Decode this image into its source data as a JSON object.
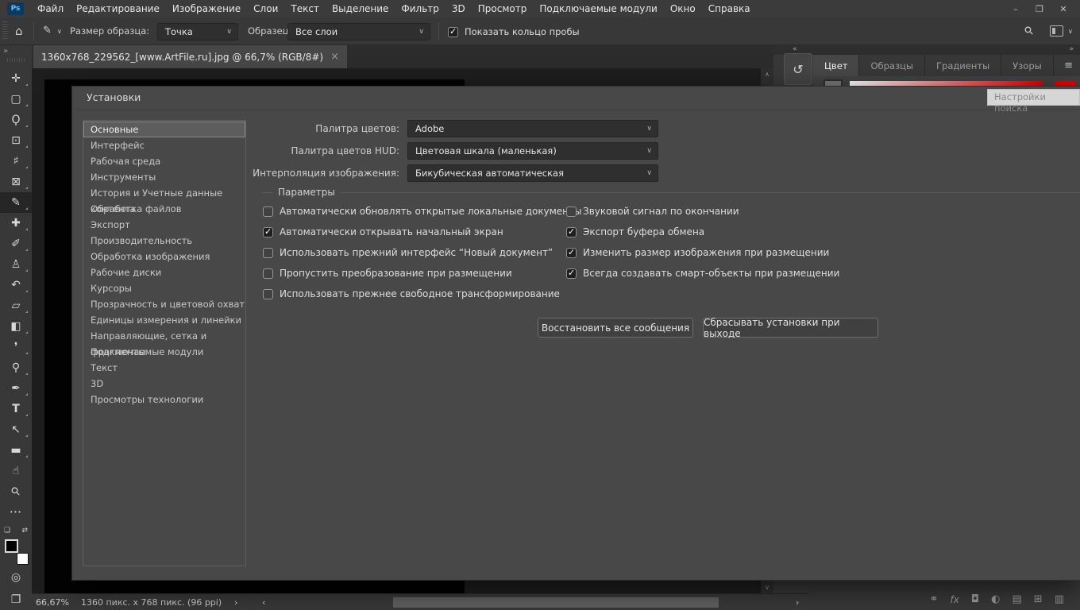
{
  "app": {
    "logo": "Ps"
  },
  "menu_bar": {
    "items": [
      {
        "label": "Файл"
      },
      {
        "label": "Редактирование"
      },
      {
        "label": "Изображение"
      },
      {
        "label": "Слои"
      },
      {
        "label": "Текст"
      },
      {
        "label": "Выделение"
      },
      {
        "label": "Фильтр"
      },
      {
        "label": "3D"
      },
      {
        "label": "Просмотр"
      },
      {
        "label": "Подключаемые модули"
      },
      {
        "label": "Окно"
      },
      {
        "label": "Справка"
      }
    ]
  },
  "window_controls": {
    "minimize": "–",
    "restore": "❐",
    "close": "✕"
  },
  "options_bar": {
    "home_icon": "⌂",
    "eyedropper_icon": "✎",
    "chevron": "∨",
    "sample_size_label": "Размер образца:",
    "sample_size_value": "Точка",
    "sample_label": "Образец:",
    "sample_value": "Все слои",
    "show_sampling_ring": {
      "label": "Показать кольцо пробы",
      "checked": true
    },
    "search_icon": "⚲",
    "workspace_chevron": "∨"
  },
  "document_tab": {
    "title": "1360x768_229562_[www.ArtFile.ru].jpg @ 66,7% (RGB/8#)",
    "close_icon": "×"
  },
  "toolbar": {
    "collapse_icon": "»",
    "tools": [
      {
        "name": "move",
        "glyph": "✛",
        "selected": false
      },
      {
        "name": "rectangular-marquee",
        "glyph": "▢",
        "selected": false
      },
      {
        "name": "lasso",
        "glyph": "Ϙ",
        "selected": false
      },
      {
        "name": "object-selection",
        "glyph": "⊡",
        "selected": false
      },
      {
        "name": "crop",
        "glyph": "♯",
        "selected": false
      },
      {
        "name": "frame",
        "glyph": "⊠",
        "selected": false
      },
      {
        "name": "eyedropper",
        "glyph": "✎",
        "selected": true
      },
      {
        "name": "healing-brush",
        "glyph": "✚",
        "selected": false
      },
      {
        "name": "brush",
        "glyph": "✐",
        "selected": false
      },
      {
        "name": "clone-stamp",
        "glyph": "♙",
        "selected": false
      },
      {
        "name": "history-brush",
        "glyph": "↶",
        "selected": false
      },
      {
        "name": "eraser",
        "glyph": "▱",
        "selected": false
      },
      {
        "name": "gradient",
        "glyph": "◧",
        "selected": false
      },
      {
        "name": "blur",
        "glyph": "❜",
        "selected": false
      },
      {
        "name": "dodge",
        "glyph": "⚲",
        "selected": false
      },
      {
        "name": "pen",
        "glyph": "✒",
        "selected": false
      },
      {
        "name": "type",
        "glyph": "T",
        "selected": false
      },
      {
        "name": "path-selection",
        "glyph": "↖",
        "selected": false
      },
      {
        "name": "rectangle",
        "glyph": "▬",
        "selected": false
      },
      {
        "name": "hand",
        "glyph": "☝",
        "selected": false
      },
      {
        "name": "zoom",
        "glyph": "⚲",
        "selected": false
      },
      {
        "name": "more-tools",
        "glyph": "•••",
        "selected": false
      }
    ],
    "default_colors_icon": "❏",
    "swap_colors_icon": "⇄",
    "quick_mask_icon": "◎",
    "screen_mode_icon": "❐",
    "colors": {
      "foreground": "#000000",
      "background": "#ffffff"
    }
  },
  "panels": {
    "collapse_left_icon": "«",
    "collapse_right_icon": "»",
    "history_icon": "↺",
    "tabs": [
      {
        "label": "Цвет",
        "active": true
      },
      {
        "label": "Образцы",
        "active": false
      },
      {
        "label": "Градиенты",
        "active": false
      },
      {
        "label": "Узоры",
        "active": false
      }
    ],
    "menu_icon": "≡",
    "color_panel": {
      "ramp_start": "#ffffff",
      "ramp_end": "#e60000",
      "swatch_color": "#e60000"
    },
    "tooltip": "Настройки поиска",
    "layers_icons": [
      {
        "name": "link",
        "glyph": "⚭"
      },
      {
        "name": "effects",
        "glyph": "fx"
      },
      {
        "name": "mask",
        "glyph": "◘"
      },
      {
        "name": "adjustment",
        "glyph": "◐"
      },
      {
        "name": "group",
        "glyph": "▤"
      },
      {
        "name": "new-layer",
        "glyph": "⊞"
      },
      {
        "name": "delete",
        "glyph": "▥"
      }
    ]
  },
  "dialog": {
    "title": "Установки",
    "sidebar": [
      {
        "label": "Основные",
        "selected": true
      },
      {
        "label": "Интерфейс",
        "selected": false
      },
      {
        "label": "Рабочая среда",
        "selected": false
      },
      {
        "label": "Инструменты",
        "selected": false
      },
      {
        "label": "История и Учетные данные контента",
        "selected": false
      },
      {
        "label": "Обработка файлов",
        "selected": false
      },
      {
        "label": "Экспорт",
        "selected": false
      },
      {
        "label": "Производительность",
        "selected": false
      },
      {
        "label": "Обработка изображения",
        "selected": false
      },
      {
        "label": "Рабочие диски",
        "selected": false
      },
      {
        "label": "Курсоры",
        "selected": false
      },
      {
        "label": "Прозрачность и цветовой охват",
        "selected": false
      },
      {
        "label": "Единицы измерения и линейки",
        "selected": false
      },
      {
        "label": "Направляющие, сетка и фрагменты",
        "selected": false
      },
      {
        "label": "Подключаемые модули",
        "selected": false
      },
      {
        "label": "Текст",
        "selected": false
      },
      {
        "label": "3D",
        "selected": false
      },
      {
        "label": "Просмотры технологии",
        "selected": false
      }
    ],
    "fields": [
      {
        "label": "Палитра цветов:",
        "value": "Adobe"
      },
      {
        "label": "Палитра цветов HUD:",
        "value": "Цветовая шкала (маленькая)"
      },
      {
        "label": "Интерполяция изображения:",
        "value": "Бикубическая автоматическая"
      }
    ],
    "section_label": "Параметры",
    "checkboxes_left": [
      {
        "label": "Автоматически обновлять открытые локальные документы",
        "checked": false
      },
      {
        "label": "Автоматически открывать начальный экран",
        "checked": true
      },
      {
        "label": "Использовать прежний интерфейс “Новый документ”",
        "checked": false
      },
      {
        "label": "Пропустить преобразование при размещении",
        "checked": false
      },
      {
        "label": "Использовать прежнее свободное трансформирование",
        "checked": false
      }
    ],
    "checkboxes_right": [
      {
        "label": "Звуковой сигнал по окончании",
        "checked": false
      },
      {
        "label": "Экспорт буфера обмена",
        "checked": true
      },
      {
        "label": "Изменить размер изображения при размещении",
        "checked": true
      },
      {
        "label": "Всегда создавать смарт-объекты при размещении",
        "checked": true
      }
    ],
    "buttons": [
      {
        "label": "Восстановить все сообщения"
      },
      {
        "label": "Сбрасывать установки при выходе"
      }
    ]
  },
  "status_bar": {
    "zoom_level": "66,67%",
    "doc_info": "1360 пикс. x 768 пикс. (96 ppi)",
    "chevron_right": "›",
    "chevron_left": "‹"
  },
  "scrollbar": {
    "up": "∧",
    "down": "∨"
  }
}
